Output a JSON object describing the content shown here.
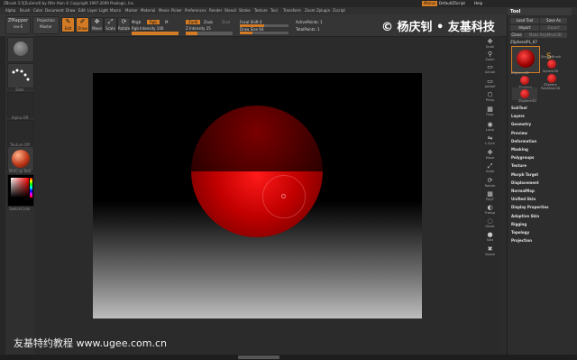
{
  "title_bar": {
    "text": "ZBrush 3.5[ZuGmrd] by Ofer Alon © Copyright 1997-2009 Pixologic, Inc.",
    "menus_btn": "Menus",
    "script_btn": "DefaultZScript",
    "help_btn": "Help"
  },
  "menubar": {
    "items": [
      "Alpha",
      "Brush",
      "Color",
      "Document",
      "Draw",
      "Edit",
      "Layer",
      "Light",
      "Macro",
      "Marker",
      "Material",
      "Movie",
      "Picker",
      "Preferences",
      "Render",
      "Stencil",
      "Stroke",
      "Texture",
      "Tool",
      "Transform",
      "Zoom",
      "Zplugin",
      "Zscript"
    ]
  },
  "topbar": {
    "zmapper": "ZMapper",
    "zmapper_rev": "rev-E",
    "projection": "Projection",
    "projection2": "Master",
    "edit": "Edit",
    "draw": "Draw",
    "move": "Move",
    "scale": "Scale",
    "rotate": "Rotate",
    "mrgb": "Mrgb",
    "rgb": "Rgb",
    "m": "M",
    "rgb_intensity": "Rgb Intensity 100",
    "zadd": "Zadd",
    "zsub": "Zsub",
    "zcut": "Zcut",
    "z_intensity": "Z Intensity 25",
    "focal_shift": "Focal Shift 0",
    "draw_size": "Draw Size 64",
    "active_points": "ActivePoints: 1",
    "total_points": "TotalPoints: 1",
    "rgb_intensity_level": 1.0,
    "z_intensity_level": 0.25,
    "focal_shift_level": 0.5,
    "draw_size_level": 0.25
  },
  "left_panel": {
    "labels": [
      "",
      "Dots",
      "Alpha Off",
      "Texture Off",
      "MatCap Red Wax"
    ],
    "switch_color": "SwitchColor"
  },
  "right_shelf": {
    "buttons": [
      "Scroll",
      "Zoom",
      "Actual",
      "AAHalf",
      "Persp",
      "Floor",
      "Local",
      "L.Sym",
      "Move",
      "Scale",
      "Rotate",
      "PolyF",
      "Transp",
      "Ghost",
      "Solo",
      "Xpose"
    ]
  },
  "tool_panel": {
    "title": "Tool",
    "load_tool": "Load Tool",
    "save_as": "Save As",
    "import": "Import",
    "export": "Export",
    "clone": "Clone",
    "make_polymesh": "Make PolyMesh3D",
    "current_tool": "ZSphere/PL_67",
    "thumbs": [
      "ZSphere3D",
      "SimpleBrush",
      "ZSphere",
      "Sphere3D",
      "ZSphere",
      "PolyMesh3D",
      "ZSphere3D"
    ],
    "sections": [
      "SubTool",
      "Layers",
      "Geometry",
      "Preview",
      "Deformation",
      "Masking",
      "Polygroups",
      "Texture",
      "Morph Target",
      "Displacement",
      "NormalMap",
      "Unified Skin",
      "Display Properties",
      "Adaptive Skin",
      "Rigging",
      "Topology",
      "Projection"
    ]
  },
  "watermarks": {
    "top": "© 杨庆钊 • 友基科技",
    "bottom": "友基特约教程 www.ugee.com.cn"
  },
  "colors": {
    "accent": "#d47c25",
    "sphere_red": "#c20000"
  }
}
